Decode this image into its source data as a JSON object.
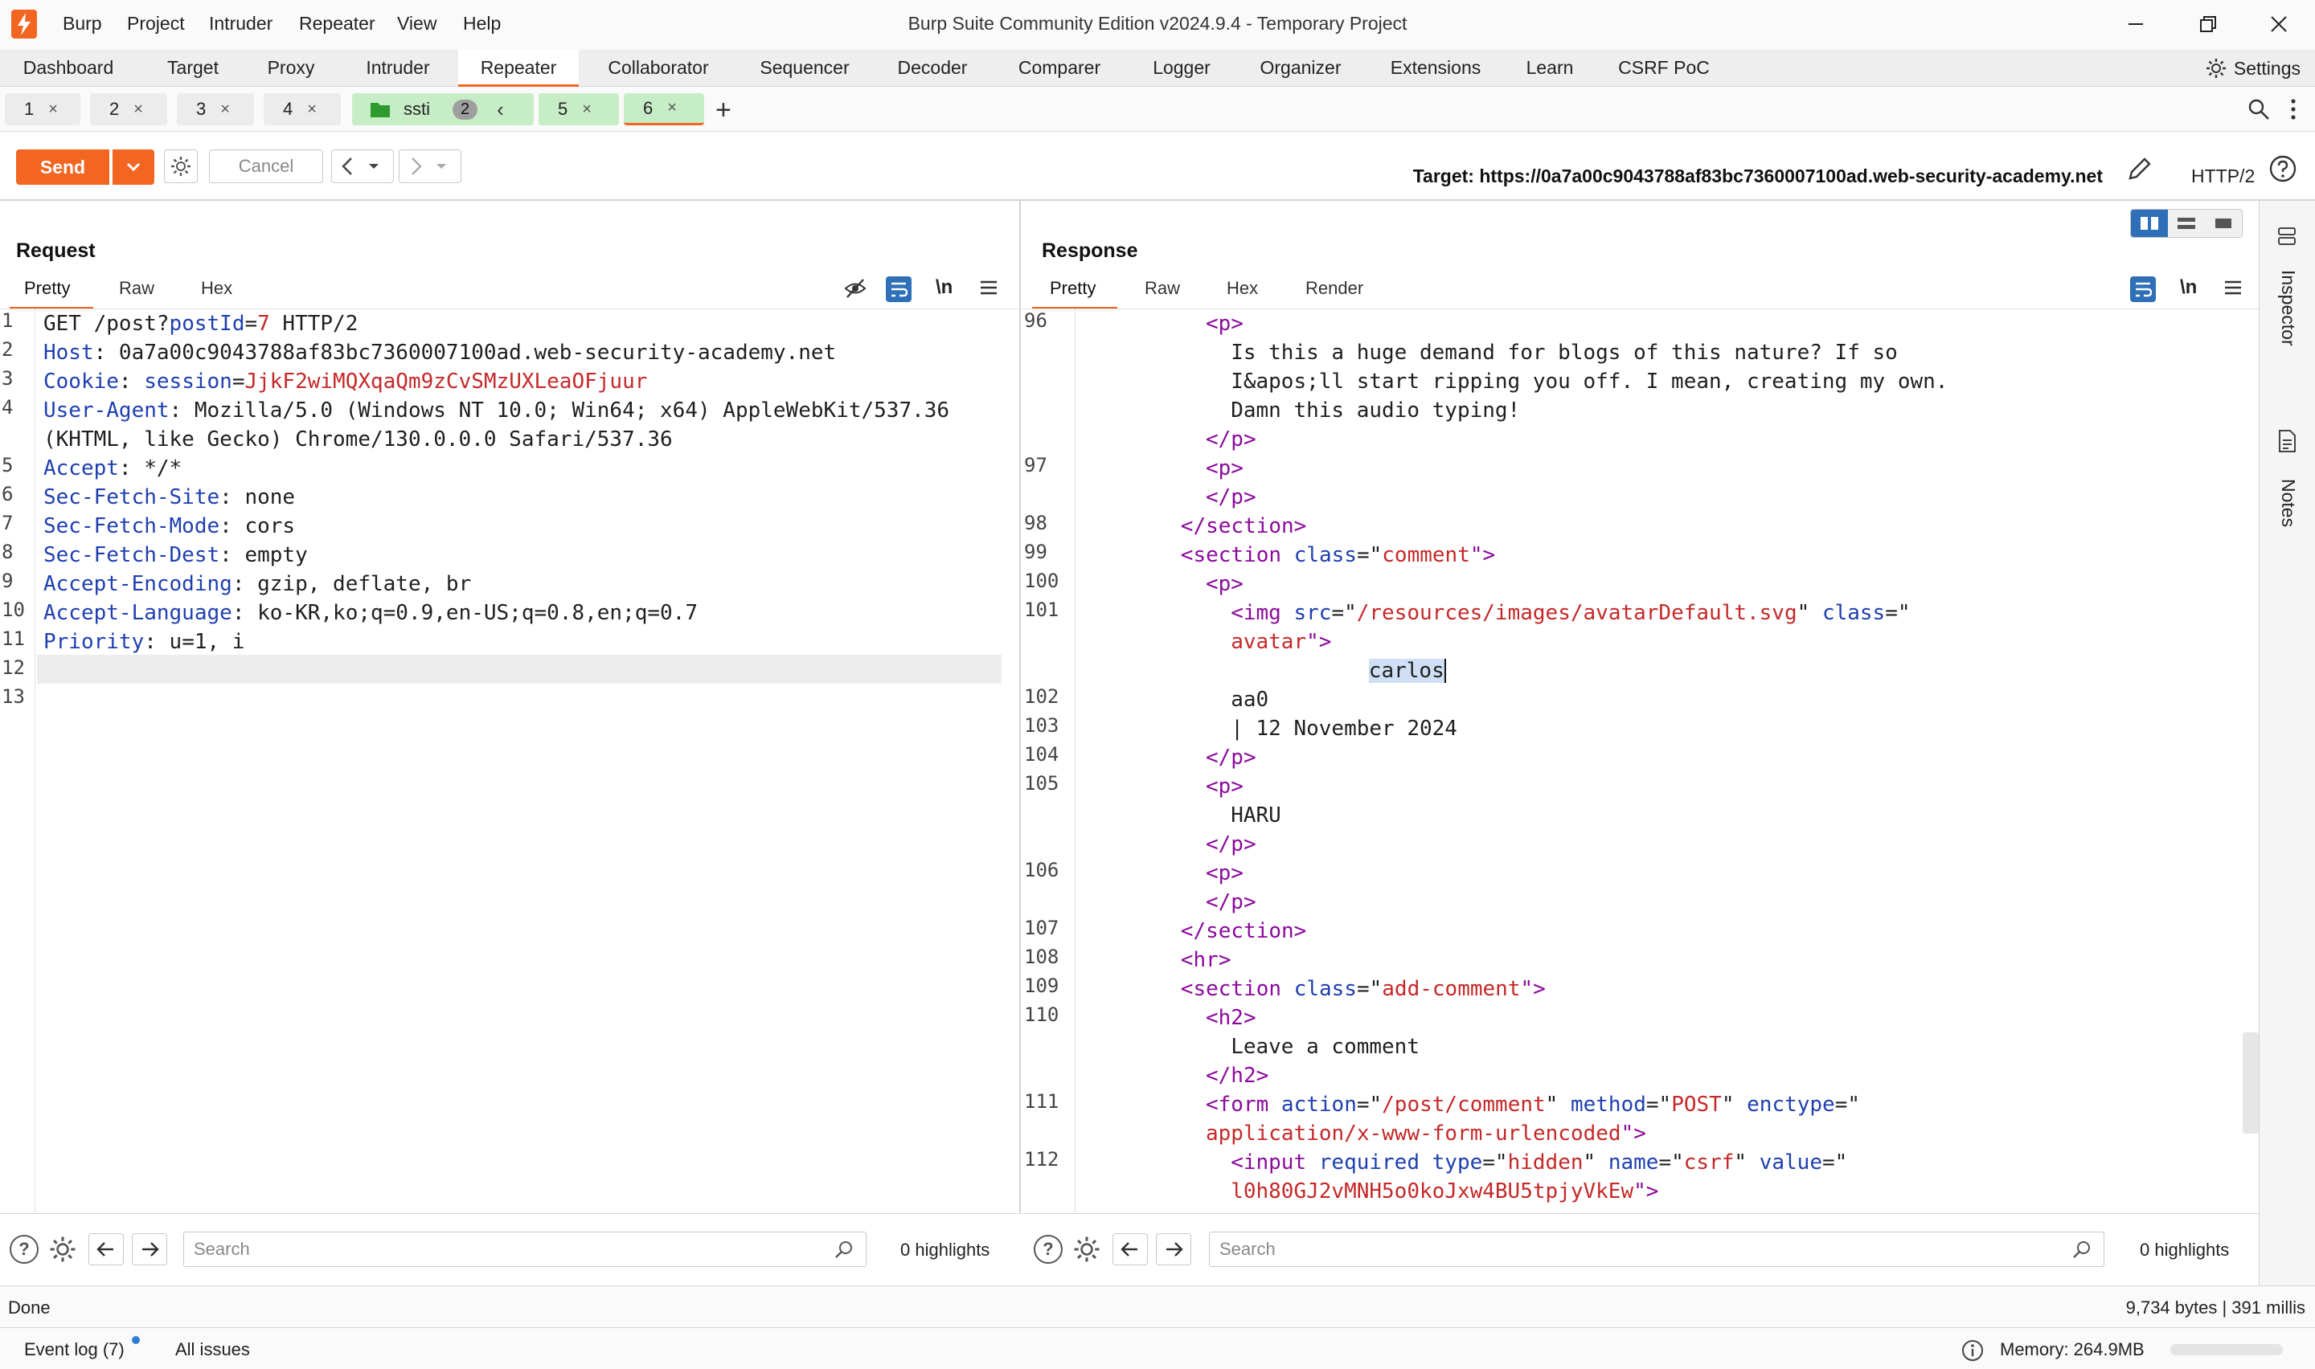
{
  "window": {
    "title": "Burp Suite Community Edition v2024.9.4 - Temporary Project",
    "menu": [
      "Burp",
      "Project",
      "Intruder",
      "Repeater",
      "View",
      "Help"
    ]
  },
  "main_tabs": [
    "Dashboard",
    "Target",
    "Proxy",
    "Intruder",
    "Repeater",
    "Collaborator",
    "Sequencer",
    "Decoder",
    "Comparer",
    "Logger",
    "Organizer",
    "Extensions",
    "Learn",
    "CSRF PoC"
  ],
  "active_main_tab": "Repeater",
  "settings_label": "Settings",
  "repeater_tabs": [
    {
      "label": "1",
      "close": "×"
    },
    {
      "label": "2",
      "close": "×"
    },
    {
      "label": "3",
      "close": "×"
    },
    {
      "label": "4",
      "close": "×"
    },
    {
      "label": "ssti",
      "badge": "2",
      "chevron": "‹"
    },
    {
      "label": "5",
      "close": "×"
    },
    {
      "label": "6",
      "close": "×"
    }
  ],
  "add_tab": "+",
  "toolbar": {
    "send": "Send",
    "cancel": "Cancel",
    "target": "Target: https://0a7a00c9043788af83bc7360007100ad.web-security-academy.net",
    "http_version": "HTTP/2"
  },
  "request": {
    "title": "Request",
    "tabs": [
      "Pretty",
      "Raw",
      "Hex"
    ],
    "newline_toggle": "\\n",
    "lines": [
      {
        "n": "1",
        "parts": [
          [
            "GET /post?",
            ""
          ],
          [
            "postId",
            "k"
          ],
          [
            "=",
            ""
          ],
          [
            "7",
            "v"
          ],
          [
            " HTTP/2",
            ""
          ]
        ]
      },
      {
        "n": "2",
        "parts": [
          [
            "Host",
            "k"
          ],
          [
            ": 0a7a00c9043788af83bc7360007100ad.web-security-academy.net",
            ""
          ]
        ]
      },
      {
        "n": "3",
        "parts": [
          [
            "Cookie",
            "k"
          ],
          [
            ": ",
            ""
          ],
          [
            "session",
            "k"
          ],
          [
            "=",
            ""
          ],
          [
            "JjkF2wiMQXqaQm9zCvSMzUXLeaOFjuur",
            "v"
          ]
        ]
      },
      {
        "n": "4",
        "parts": [
          [
            "User-Agent",
            "k"
          ],
          [
            ": Mozilla/5.0 (Windows NT 10.0; Win64; x64) AppleWebKit/537.36",
            ""
          ]
        ]
      },
      {
        "n": "",
        "parts": [
          [
            "(KHTML, like Gecko) Chrome/130.0.0.0 Safari/537.36",
            ""
          ]
        ]
      },
      {
        "n": "5",
        "parts": [
          [
            "Accept",
            "k"
          ],
          [
            ": */*",
            ""
          ]
        ]
      },
      {
        "n": "6",
        "parts": [
          [
            "Sec-Fetch-Site",
            "k"
          ],
          [
            ": none",
            ""
          ]
        ]
      },
      {
        "n": "7",
        "parts": [
          [
            "Sec-Fetch-Mode",
            "k"
          ],
          [
            ": cors",
            ""
          ]
        ]
      },
      {
        "n": "8",
        "parts": [
          [
            "Sec-Fetch-Dest",
            "k"
          ],
          [
            ": empty",
            ""
          ]
        ]
      },
      {
        "n": "9",
        "parts": [
          [
            "Accept-Encoding",
            "k"
          ],
          [
            ": gzip, deflate, br",
            ""
          ]
        ]
      },
      {
        "n": "10",
        "parts": [
          [
            "Accept-Language",
            "k"
          ],
          [
            ": ko-KR,ko;q=0.9,en-US;q=0.8,en;q=0.7",
            ""
          ]
        ]
      },
      {
        "n": "11",
        "parts": [
          [
            "Priority",
            "k"
          ],
          [
            ": u=1, i",
            ""
          ]
        ]
      },
      {
        "n": "12",
        "parts": []
      },
      {
        "n": "13",
        "parts": []
      }
    ],
    "search_placeholder": "Search",
    "highlights": "0 highlights"
  },
  "response": {
    "title": "Response",
    "tabs": [
      "Pretty",
      "Raw",
      "Hex",
      "Render"
    ],
    "newline_toggle": "\\n",
    "lines": [
      {
        "n": "96",
        "indent": 10,
        "parts": [
          [
            "<p>",
            "tag"
          ]
        ]
      },
      {
        "n": "",
        "indent": 12,
        "parts": [
          [
            "Is this a huge demand for blogs of this nature? If so",
            ""
          ]
        ]
      },
      {
        "n": "",
        "indent": 12,
        "parts": [
          [
            "I&apos;ll start ripping you off. I mean, creating my own.",
            ""
          ]
        ]
      },
      {
        "n": "",
        "indent": 12,
        "parts": [
          [
            "Damn this audio typing!",
            ""
          ]
        ]
      },
      {
        "n": "",
        "indent": 10,
        "parts": [
          [
            "</p>",
            "tag"
          ]
        ]
      },
      {
        "n": "97",
        "indent": 10,
        "parts": [
          [
            "<p>",
            "tag"
          ]
        ]
      },
      {
        "n": "",
        "indent": 10,
        "parts": [
          [
            "</p>",
            "tag"
          ]
        ]
      },
      {
        "n": "98",
        "indent": 8,
        "parts": [
          [
            "</section>",
            "tag"
          ]
        ]
      },
      {
        "n": "99",
        "indent": 8,
        "parts": [
          [
            "<section ",
            "tag"
          ],
          [
            "class",
            "attr"
          ],
          [
            "=\"",
            ""
          ],
          [
            "comment",
            "str"
          ],
          [
            "\">",
            "tag"
          ]
        ]
      },
      {
        "n": "100",
        "indent": 10,
        "parts": [
          [
            "<p>",
            "tag"
          ]
        ]
      },
      {
        "n": "101",
        "indent": 12,
        "parts": [
          [
            "<img ",
            "tag"
          ],
          [
            "src",
            "attr"
          ],
          [
            "=\"",
            ""
          ],
          [
            "/resources/images/avatarDefault.svg",
            "str"
          ],
          [
            "\" ",
            ""
          ],
          [
            "class",
            "attr"
          ],
          [
            "=\"",
            ""
          ]
        ]
      },
      {
        "n": "",
        "indent": 12,
        "parts": [
          [
            "avatar",
            "str"
          ],
          [
            "\">",
            "tag"
          ]
        ]
      },
      {
        "n": "",
        "indent": 23,
        "parts": [
          [
            "carlos",
            "sel"
          ]
        ]
      },
      {
        "n": "102",
        "indent": 12,
        "parts": [
          [
            "aa0",
            ""
          ]
        ]
      },
      {
        "n": "103",
        "indent": 12,
        "parts": [
          [
            "| 12 November 2024",
            ""
          ]
        ]
      },
      {
        "n": "104",
        "indent": 10,
        "parts": [
          [
            "</p>",
            "tag"
          ]
        ]
      },
      {
        "n": "105",
        "indent": 10,
        "parts": [
          [
            "<p>",
            "tag"
          ]
        ]
      },
      {
        "n": "",
        "indent": 12,
        "parts": [
          [
            "HARU",
            ""
          ]
        ]
      },
      {
        "n": "",
        "indent": 10,
        "parts": [
          [
            "</p>",
            "tag"
          ]
        ]
      },
      {
        "n": "106",
        "indent": 10,
        "parts": [
          [
            "<p>",
            "tag"
          ]
        ]
      },
      {
        "n": "",
        "indent": 10,
        "parts": [
          [
            "</p>",
            "tag"
          ]
        ]
      },
      {
        "n": "107",
        "indent": 8,
        "parts": [
          [
            "</section>",
            "tag"
          ]
        ]
      },
      {
        "n": "108",
        "indent": 8,
        "parts": [
          [
            "<hr>",
            "tag"
          ]
        ]
      },
      {
        "n": "109",
        "indent": 8,
        "parts": [
          [
            "<section ",
            "tag"
          ],
          [
            "class",
            "attr"
          ],
          [
            "=\"",
            ""
          ],
          [
            "add-comment",
            "str"
          ],
          [
            "\">",
            "tag"
          ]
        ]
      },
      {
        "n": "110",
        "indent": 10,
        "parts": [
          [
            "<h2>",
            "tag"
          ]
        ]
      },
      {
        "n": "",
        "indent": 12,
        "parts": [
          [
            "Leave a comment",
            ""
          ]
        ]
      },
      {
        "n": "",
        "indent": 10,
        "parts": [
          [
            "</h2>",
            "tag"
          ]
        ]
      },
      {
        "n": "111",
        "indent": 10,
        "parts": [
          [
            "<form ",
            "tag"
          ],
          [
            "action",
            "attr"
          ],
          [
            "=\"",
            ""
          ],
          [
            "/post/comment",
            "str"
          ],
          [
            "\" ",
            ""
          ],
          [
            "method",
            "attr"
          ],
          [
            "=\"",
            ""
          ],
          [
            "POST",
            "str"
          ],
          [
            "\" ",
            ""
          ],
          [
            "enctype",
            "attr"
          ],
          [
            "=\"",
            ""
          ]
        ]
      },
      {
        "n": "",
        "indent": 10,
        "parts": [
          [
            "application/x-www-form-urlencoded",
            "str"
          ],
          [
            "\">",
            "tag"
          ]
        ]
      },
      {
        "n": "112",
        "indent": 12,
        "parts": [
          [
            "<input ",
            "tag"
          ],
          [
            "required ",
            "attr"
          ],
          [
            "type",
            "attr"
          ],
          [
            "=\"",
            ""
          ],
          [
            "hidden",
            "str"
          ],
          [
            "\" ",
            ""
          ],
          [
            "name",
            "attr"
          ],
          [
            "=\"",
            ""
          ],
          [
            "csrf",
            "str"
          ],
          [
            "\" ",
            ""
          ],
          [
            "value",
            "attr"
          ],
          [
            "=\"",
            ""
          ]
        ]
      },
      {
        "n": "",
        "indent": 12,
        "parts": [
          [
            "l0h80GJ2vMNH5o0koJxw4BU5tpjyVkEw",
            "str"
          ],
          [
            "\">",
            "tag"
          ]
        ]
      }
    ],
    "search_placeholder": "Search",
    "highlights": "0 highlights"
  },
  "side_rail": [
    "Inspector",
    "Notes"
  ],
  "status": {
    "left": "Done",
    "right": "9,734 bytes | 391 millis"
  },
  "bottom": {
    "event_log": "Event log (7)",
    "all_issues": "All issues",
    "memory": "Memory: 264.9MB"
  }
}
